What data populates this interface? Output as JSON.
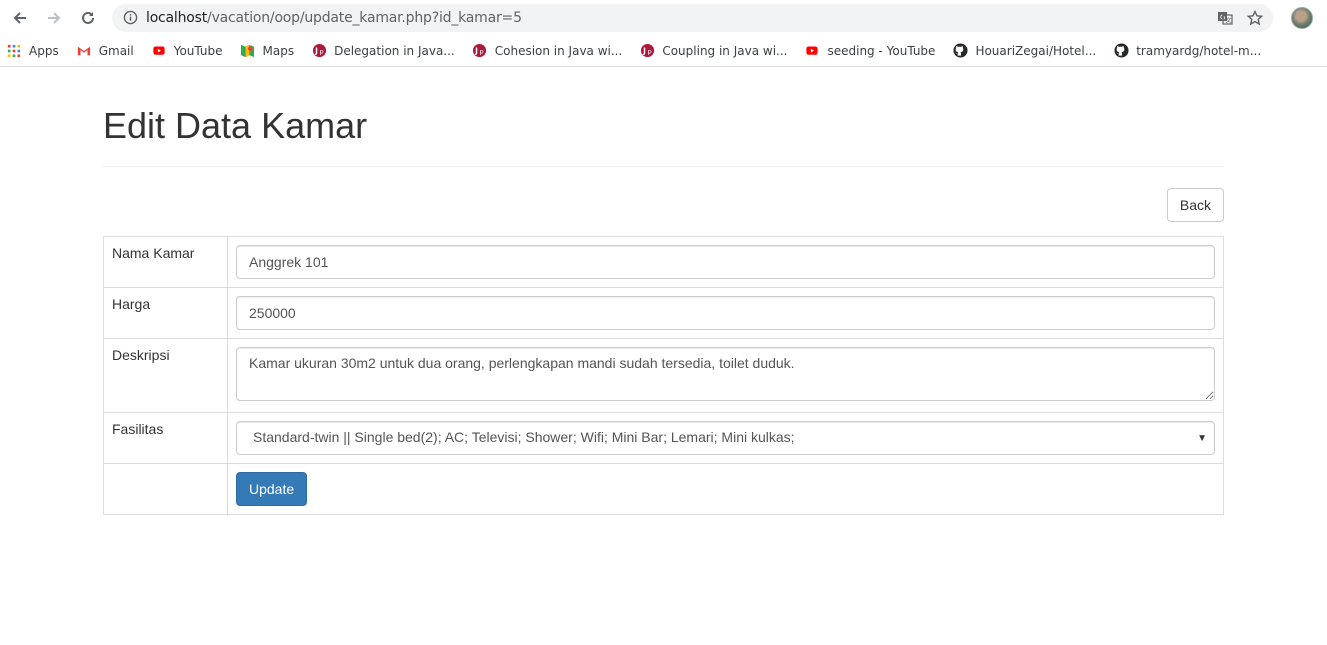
{
  "browser": {
    "url_host": "localhost",
    "url_path": "/vacation/oop/update_kamar.php?id_kamar=5",
    "bookmarks": [
      {
        "label": "Apps",
        "icon": "apps-grid-icon"
      },
      {
        "label": "Gmail",
        "icon": "gmail-icon"
      },
      {
        "label": "YouTube",
        "icon": "youtube-icon"
      },
      {
        "label": "Maps",
        "icon": "maps-icon"
      },
      {
        "label": "Delegation in Java...",
        "icon": "javatpoint-icon"
      },
      {
        "label": "Cohesion in Java wi...",
        "icon": "javatpoint-icon"
      },
      {
        "label": "Coupling in Java wi...",
        "icon": "javatpoint-icon"
      },
      {
        "label": "seeding - YouTube",
        "icon": "youtube-icon"
      },
      {
        "label": "HouariZegai/Hotel...",
        "icon": "github-icon"
      },
      {
        "label": "tramyardg/hotel-m...",
        "icon": "github-icon"
      }
    ]
  },
  "page": {
    "title": "Edit Data Kamar",
    "back_label": "Back",
    "update_label": "Update"
  },
  "form": {
    "nama_label": "Nama Kamar",
    "nama_value": "Anggrek 101",
    "harga_label": "Harga",
    "harga_value": "250000",
    "deskripsi_label": "Deskripsi",
    "deskripsi_value": "Kamar ukuran 30m2 untuk dua orang, perlengkapan mandi sudah tersedia, toilet duduk.",
    "fasilitas_label": "Fasilitas",
    "fasilitas_value": "Standard-twin || Single bed(2); AC; Televisi; Shower; Wifi; Mini Bar; Lemari; Mini kulkas;"
  },
  "colors": {
    "primary": "#337ab7",
    "youtube": "#ff0000",
    "javatpoint": "#b0153b"
  }
}
